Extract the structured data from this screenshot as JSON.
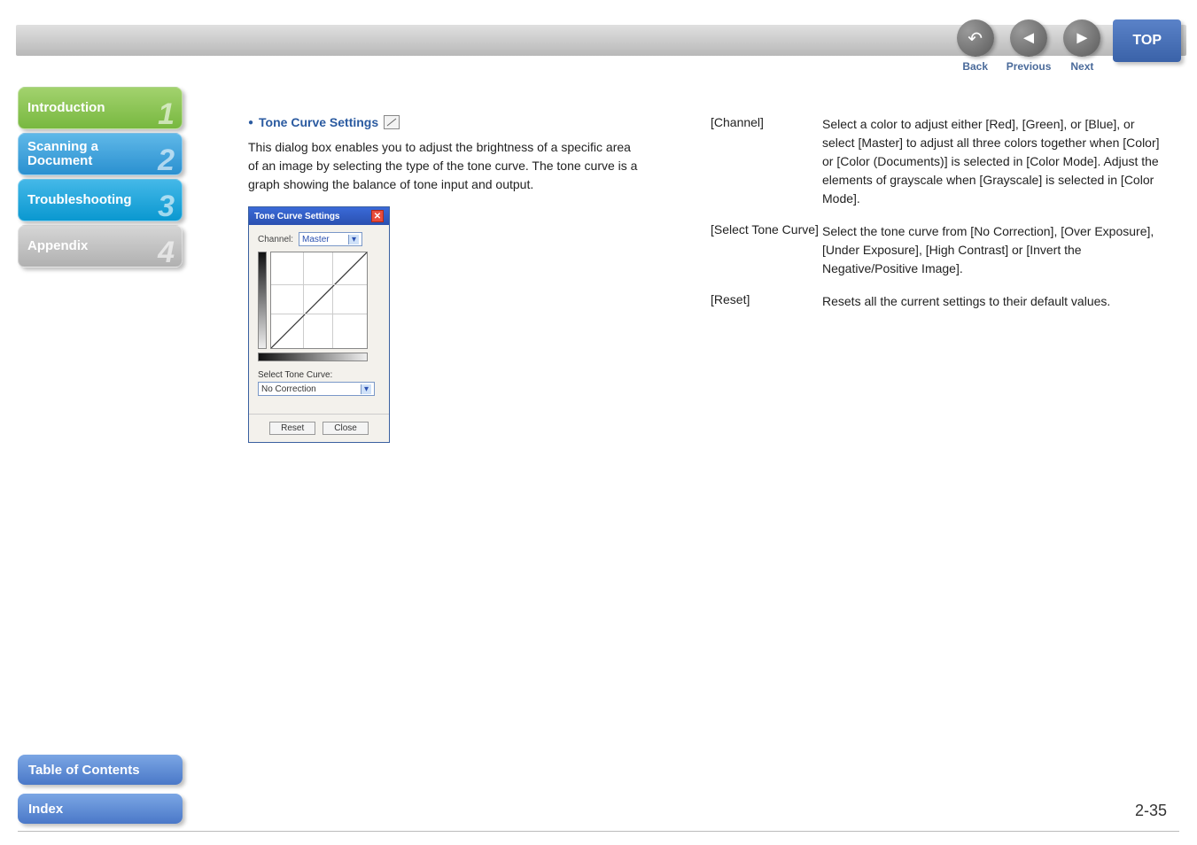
{
  "topbar": {
    "back_label": "Back",
    "previous_label": "Previous",
    "next_label": "Next",
    "top_label": "TOP"
  },
  "sidenav": {
    "items": [
      {
        "label": "Introduction",
        "num": "1"
      },
      {
        "label": "Scanning a\nDocument",
        "num": "2"
      },
      {
        "label": "Troubleshooting",
        "num": "3"
      },
      {
        "label": "Appendix",
        "num": "4"
      }
    ],
    "toc_label": "Table of Contents",
    "index_label": "Index"
  },
  "page_number": "2-35",
  "content": {
    "heading": "Tone Curve Settings",
    "paragraph": "This dialog box enables you to adjust the brightness of a specific area of an image by selecting the type of the tone curve. The tone curve is a graph showing the balance of tone input and output.",
    "dialog": {
      "title": "Tone Curve Settings",
      "channel_label": "Channel:",
      "channel_value": "Master",
      "select_tone_label": "Select Tone Curve:",
      "select_tone_value": "No Correction",
      "reset_label": "Reset",
      "close_label": "Close"
    },
    "definitions": [
      {
        "term": "[Channel]",
        "desc": "Select a color to adjust either [Red], [Green], or [Blue], or select [Master] to adjust all three colors together when [Color] or [Color (Documents)] is selected in [Color Mode]. Adjust the elements of grayscale when [Grayscale] is selected in [Color Mode]."
      },
      {
        "term": "[Select Tone Curve]",
        "desc": "Select the tone curve from [No Correction], [Over Exposure], [Under Exposure], [High Contrast] or [Invert the Negative/Positive Image]."
      },
      {
        "term": "[Reset]",
        "desc": "Resets all the current settings to their default values."
      }
    ]
  }
}
